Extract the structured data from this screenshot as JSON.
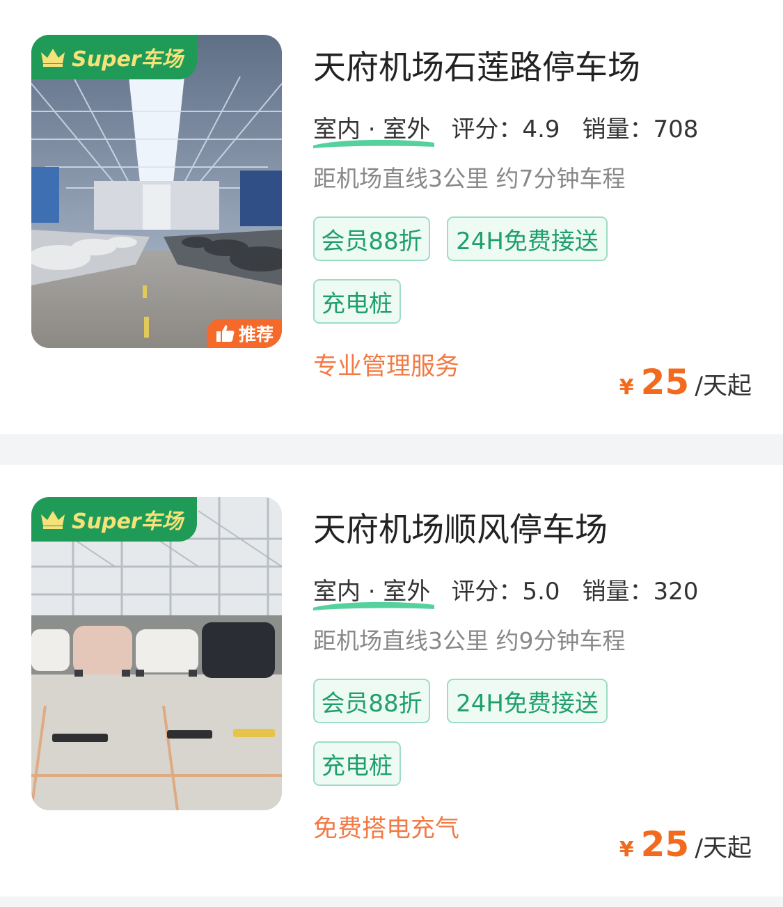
{
  "colors": {
    "accent_green": "#1f9a57",
    "tag_green": "#1f9f6c",
    "price_orange": "#f26a1e",
    "promo_orange": "#f27a45"
  },
  "lots": [
    {
      "super_label": "Super车场",
      "recommend_label": "推荐",
      "title": "天府机场石莲路停车场",
      "env": "室内 · 室外",
      "rating": "评分：4.9",
      "sales": "销量：708",
      "distance": "距机场直线3公里 约7分钟车程",
      "tags": [
        "会员88折",
        "24H免费接送",
        "充电桩"
      ],
      "promo": "专业管理服务",
      "price_symbol": "¥",
      "price": "25",
      "price_unit": "/天起"
    },
    {
      "super_label": "Super车场",
      "title": "天府机场顺风停车场",
      "env": "室内 · 室外",
      "rating": "评分：5.0",
      "sales": "销量：320",
      "distance": "距机场直线3公里 约9分钟车程",
      "tags": [
        "会员88折",
        "24H免费接送",
        "充电桩"
      ],
      "promo": "免费搭电充气",
      "price_symbol": "¥",
      "price": "25",
      "price_unit": "/天起"
    }
  ]
}
